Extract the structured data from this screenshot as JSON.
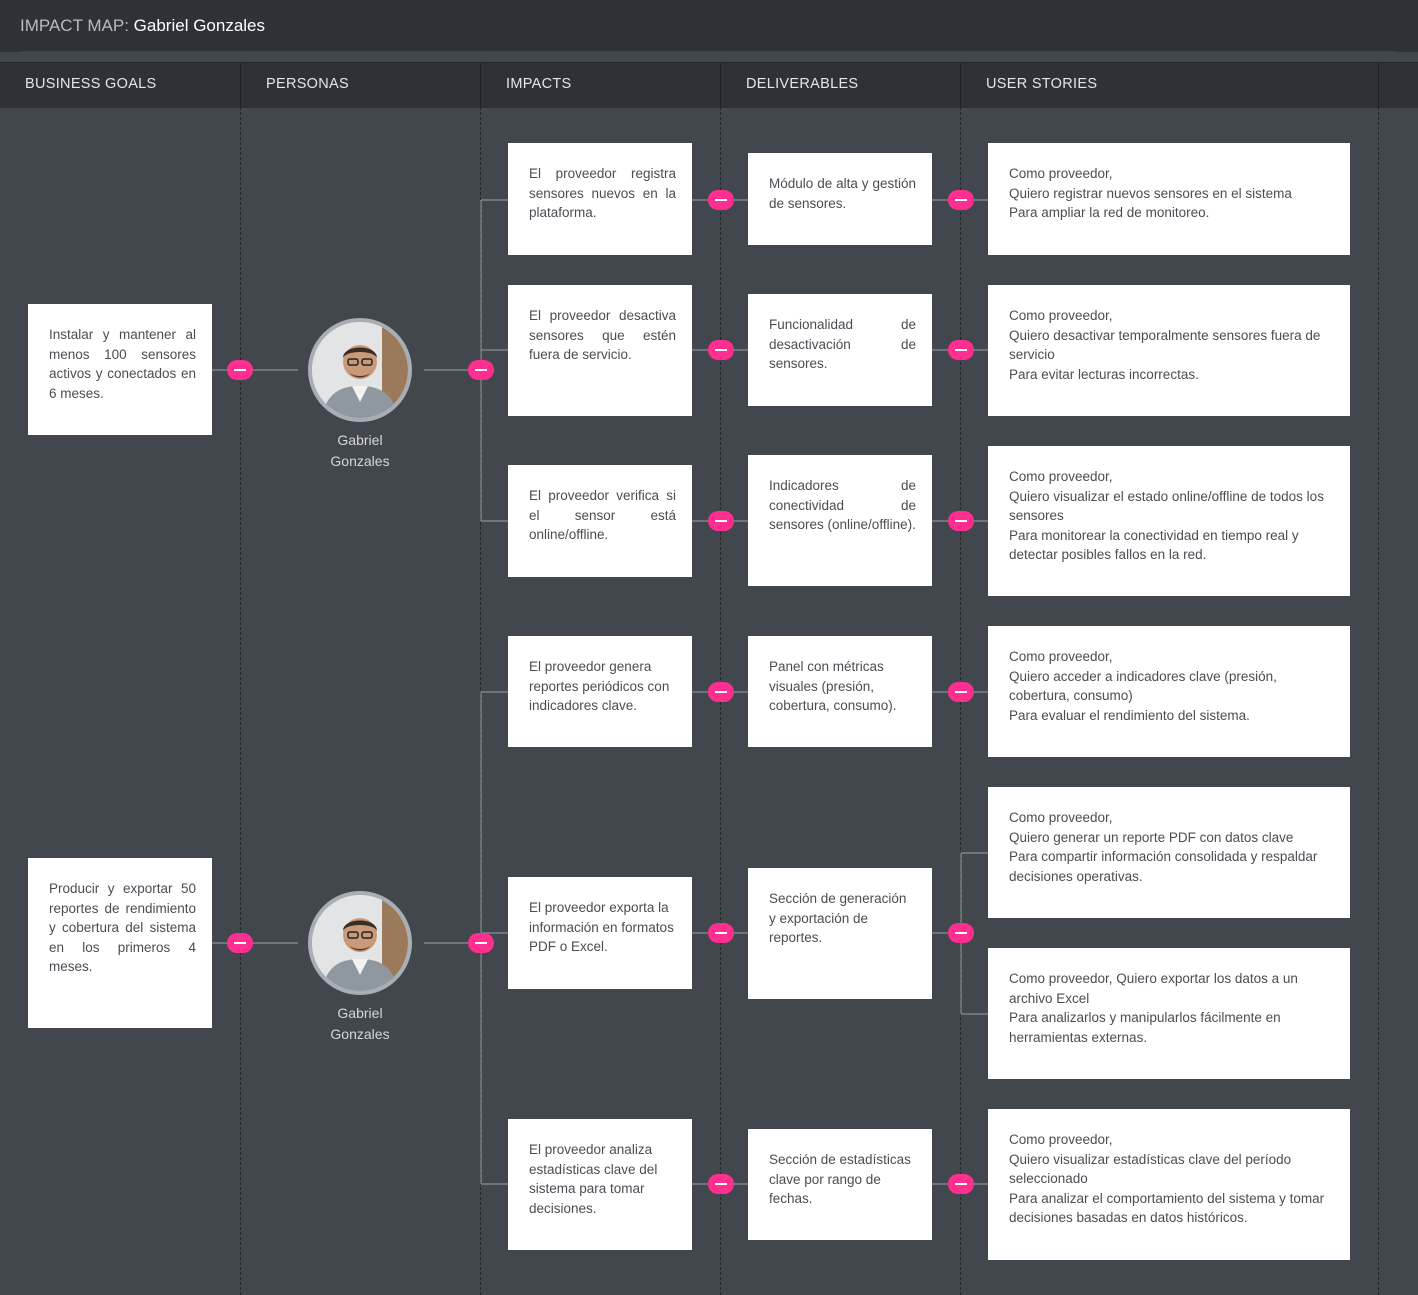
{
  "title": {
    "prefix": "IMPACT MAP: ",
    "name": "Gabriel Gonzales"
  },
  "columns": [
    "BUSINESS GOALS",
    "PERSONAS",
    "IMPACTS",
    "DELIVERABLES",
    "USER STORIES"
  ],
  "goals": [
    "Instalar y mantener al menos 100 sensores activos y conectados en 6 meses.",
    "Producir y exportar 50 reportes de rendimiento y cobertura del sistema en los primeros 4 meses."
  ],
  "personas": [
    {
      "name_line1": "Gabriel",
      "name_line2": "Gonzales"
    },
    {
      "name_line1": "Gabriel",
      "name_line2": "Gonzales"
    }
  ],
  "impacts": [
    "El proveedor registra sensores nuevos en la plataforma.",
    "El proveedor desactiva sensores que estén fuera de servicio.",
    "El proveedor verifica si el sensor está online/offline.",
    "El proveedor genera reportes periódicos con indicadores clave.",
    "El proveedor exporta la información en formatos PDF o Excel.",
    "El proveedor analiza estadísticas clave del sistema para tomar decisiones."
  ],
  "deliverables": [
    "Módulo de alta y gestión de sensores.",
    "Funcionalidad de desactivación de sensores.",
    "Indicadores de conectividad de sensores (online/offline).",
    "Panel con métricas visuales (presión, cobertura, consumo).",
    "Sección de generación y exportación de reportes.",
    "Sección de estadísticas clave por rango de fechas."
  ],
  "stories": [
    "Como proveedor,\nQuiero registrar nuevos sensores en el sistema\nPara ampliar la red de monitoreo.",
    "Como proveedor,\nQuiero desactivar temporalmente sensores fuera de servicio\nPara evitar lecturas incorrectas.",
    "Como proveedor,\nQuiero visualizar el estado online/offline de todos los sensores\nPara monitorear la conectividad en tiempo real y detectar posibles fallos en la red.",
    "Como proveedor,\nQuiero acceder a indicadores clave (presión, cobertura, consumo)\nPara evaluar el rendimiento del sistema.",
    "Como proveedor,\nQuiero generar un reporte PDF con datos clave\nPara compartir información consolidada y respaldar decisiones operativas.",
    "Como proveedor, Quiero exportar los datos a un archivo Excel\nPara analizarlos y manipularlos fácilmente en herramientas externas.",
    "Como proveedor,\nQuiero visualizar estadísticas clave del período seleccionado\nPara analizar el comportamiento del sistema y tomar decisiones basadas en datos históricos."
  ],
  "colors": {
    "background": "#42464d",
    "header": "#2e3138",
    "card": "#ffffff",
    "toggle": "#ff2e8f",
    "connector": "#8a8e95"
  },
  "icons": {
    "toggle": "collapse-toggle-icon",
    "avatar": "persona-avatar"
  }
}
